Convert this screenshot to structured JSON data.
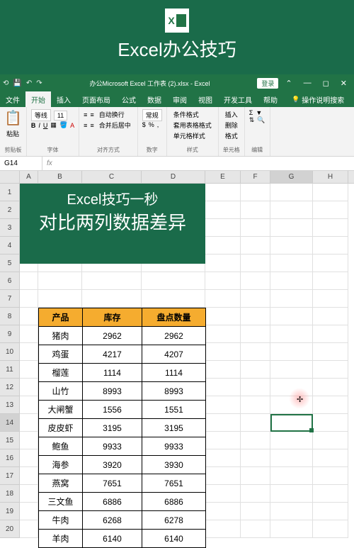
{
  "banner": {
    "title": "Excel办公技巧"
  },
  "titlebar": {
    "filename": "办公Microsoft Excel 工作表 (2).xlsx - Excel",
    "login": "登录"
  },
  "tabs": {
    "file": "文件",
    "home": "开始",
    "insert": "插入",
    "layout": "页面布局",
    "formulas": "公式",
    "data": "数据",
    "review": "审阅",
    "view": "视图",
    "dev": "开发工具",
    "help": "帮助",
    "tell": "操作说明搜索"
  },
  "ribbon": {
    "clipboard": "剪贴板",
    "paste": "粘贴",
    "font": "字体",
    "fontname": "等线",
    "fontsize": "11",
    "align": "对齐方式",
    "wrap": "自动换行",
    "merge": "合并后居中",
    "number": "数字",
    "general": "常规",
    "styles": "样式",
    "cond": "条件格式",
    "tablefmt": "套用表格格式",
    "cellstyle": "单元格样式",
    "cells": "单元格",
    "ins": "插入",
    "del": "删除",
    "fmt": "格式",
    "editing": "编辑"
  },
  "namebox": "G14",
  "columns": [
    "A",
    "B",
    "C",
    "D",
    "E",
    "F",
    "G",
    "H"
  ],
  "overlay": {
    "line1": "Excel技巧一秒",
    "line2": "对比两列数据差异"
  },
  "headers": {
    "product": "产品",
    "stock": "库存",
    "count": "盘点数量"
  },
  "rows_start": 8,
  "data": [
    {
      "p": "猪肉",
      "s": 2962,
      "c": 2962
    },
    {
      "p": "鸡蛋",
      "s": 4217,
      "c": 4207
    },
    {
      "p": "榴莲",
      "s": 1114,
      "c": 1114
    },
    {
      "p": "山竹",
      "s": 8993,
      "c": 8993
    },
    {
      "p": "大闸蟹",
      "s": 1556,
      "c": 1551
    },
    {
      "p": "皮皮虾",
      "s": 3195,
      "c": 3195
    },
    {
      "p": "鲍鱼",
      "s": 9933,
      "c": 9933
    },
    {
      "p": "海参",
      "s": 3920,
      "c": 3930
    },
    {
      "p": "燕窝",
      "s": 7651,
      "c": 7651
    },
    {
      "p": "三文鱼",
      "s": 6886,
      "c": 6886
    },
    {
      "p": "牛肉",
      "s": 6268,
      "c": 6278
    },
    {
      "p": "羊肉",
      "s": 6140,
      "c": 6140
    }
  ],
  "chart_data": {
    "type": "table",
    "title": "Excel技巧一秒 对比两列数据差异",
    "columns": [
      "产品",
      "库存",
      "盘点数量"
    ],
    "rows": [
      [
        "猪肉",
        2962,
        2962
      ],
      [
        "鸡蛋",
        4217,
        4207
      ],
      [
        "榴莲",
        1114,
        1114
      ],
      [
        "山竹",
        8993,
        8993
      ],
      [
        "大闸蟹",
        1556,
        1551
      ],
      [
        "皮皮虾",
        3195,
        3195
      ],
      [
        "鲍鱼",
        9933,
        9933
      ],
      [
        "海参",
        3920,
        3930
      ],
      [
        "燕窝",
        7651,
        7651
      ],
      [
        "三文鱼",
        6886,
        6886
      ],
      [
        "牛肉",
        6268,
        6278
      ],
      [
        "羊肉",
        6140,
        6140
      ]
    ]
  }
}
